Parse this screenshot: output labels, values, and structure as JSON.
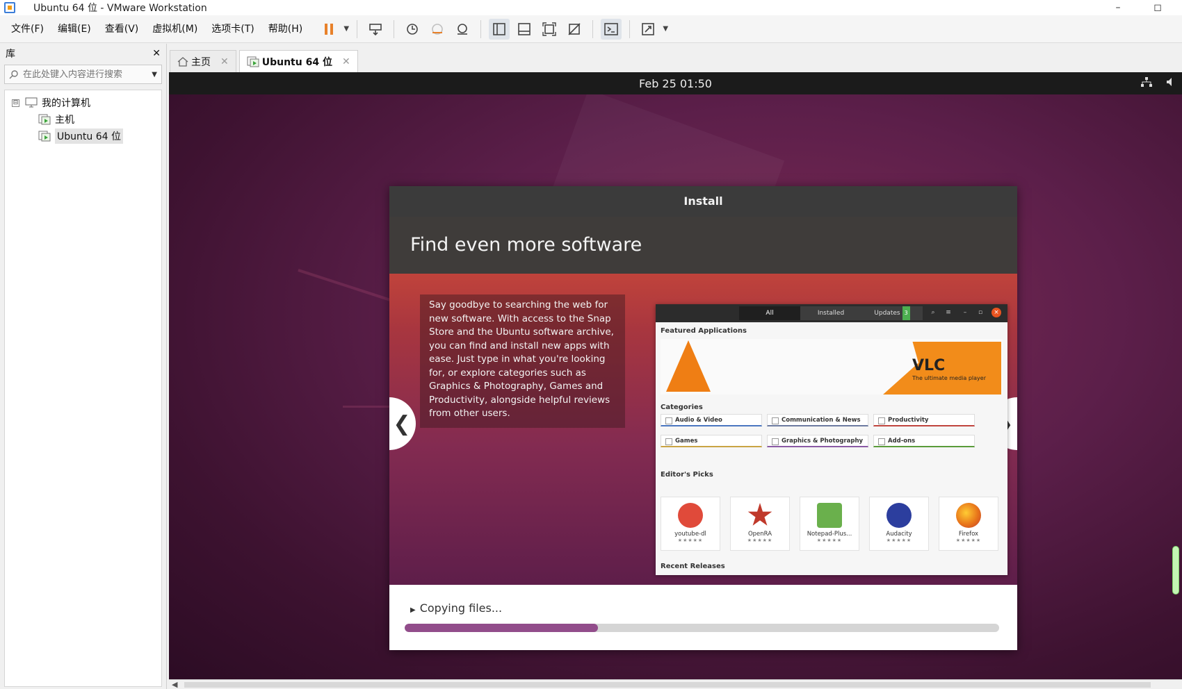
{
  "window": {
    "title": "Ubuntu 64 位 - VMware Workstation",
    "minimize": "–",
    "maximize": "◻"
  },
  "menu": [
    "文件(F)",
    "编辑(E)",
    "查看(V)",
    "虚拟机(M)",
    "选项卡(T)",
    "帮助(H)"
  ],
  "library": {
    "title": "库",
    "close": "✕",
    "search_placeholder": "在此处键入内容进行搜索",
    "tree": {
      "root": "我的计算机",
      "expander": "⊟",
      "children": [
        "主机",
        "Ubuntu 64 位"
      ]
    }
  },
  "tabs": [
    {
      "label": "主页",
      "close": "✕"
    },
    {
      "label": "Ubuntu 64 位",
      "close": "✕"
    }
  ],
  "guest": {
    "clock": "Feb 25  01:50",
    "installer": {
      "window_title": "Install",
      "heading": "Find even more software",
      "slide_text": "Say goodbye to searching the web for new software. With access to the Snap Store and the Ubuntu software archive, you can find and install new apps with ease. Just type in what you're looking for, or explore categories such as Graphics & Photography, Games and Productivity, alongside helpful reviews from other users.",
      "prev": "❮",
      "next": "❯",
      "mock": {
        "tabs": [
          "All",
          "Installed",
          "Updates"
        ],
        "updates_badge": "3",
        "featured_title": "Featured Applications",
        "banner_title": "VLC",
        "banner_subtitle": "The ultimate media player",
        "categories_title": "Categories",
        "categories": [
          "Audio & Video",
          "Communication & News",
          "Productivity",
          "Games",
          "Graphics & Photography",
          "Add-ons"
        ],
        "editors_picks_title": "Editor's Picks",
        "picks": [
          {
            "name": "youtube-dl",
            "color": "#e04a3a"
          },
          {
            "name": "OpenRA",
            "color": "#c0392b"
          },
          {
            "name": "Notepad-Plus...",
            "color": "#6ab04c"
          },
          {
            "name": "Audacity",
            "color": "#2c3e9e"
          },
          {
            "name": "Firefox",
            "color": "#e8751a"
          }
        ],
        "stars": "★★★★★",
        "recent_title": "Recent Releases"
      },
      "progress": {
        "label": "Copying files...",
        "fraction": 0.325,
        "color": "#924d8b"
      }
    }
  }
}
